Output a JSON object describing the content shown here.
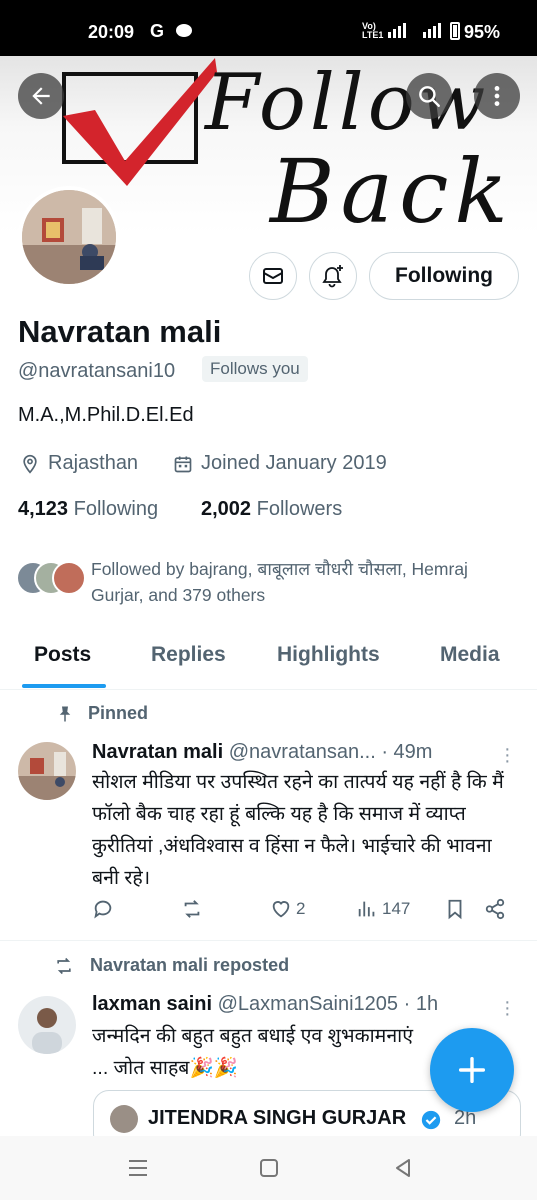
{
  "status_bar": {
    "time": "20:09",
    "g_icon": "G",
    "network": "Vo) 5G LTE1",
    "battery": "95%"
  },
  "banner": {
    "line1": "Follow",
    "line2": "Back"
  },
  "profile": {
    "name": "Navratan mali",
    "handle": "@navratansani10",
    "follows_you": "Follows you",
    "bio": "M.A.,M.Phil.D.El.Ed",
    "location": "Rajasthan",
    "joined": "Joined January 2019",
    "following_count": "4,123",
    "following_label": "Following",
    "followers_count": "2,002",
    "followers_label": "Followers",
    "followed_by": "Followed by bajrang, बाबूलाल चौधरी चौसला, Hemraj Gurjar, and 379 others",
    "following_button": "Following"
  },
  "tabs": [
    "Posts",
    "Replies",
    "Highlights",
    "Media"
  ],
  "active_tab": "Posts",
  "posts": [
    {
      "context": "Pinned",
      "author": "Navratan mali",
      "handle_time": "@navratansan... · 49m",
      "text": "सोशल मीडिया पर उपस्थित रहने का तात्पर्य यह नहीं है कि मैं फॉलो बैक चाह रहा हूं बल्कि यह है कि समाज में व्याप्त कुरीतियां ,अंधविश्वास व हिंसा न फैले। भाईचारे की भावना बनी रहे।",
      "likes": "2",
      "views": "147"
    },
    {
      "context": "Navratan mali reposted",
      "author": "laxman saini",
      "handle_time": "@LaxmanSaini1205 · 1h",
      "text": "जन्मदिन की बहुत बहुत बधाई एव शुभकामनाएं ... जोत साहब🎉🎉",
      "quote_author": "JITENDRA SINGH GURJAR",
      "quote_time": "2h"
    }
  ],
  "colors": {
    "accent": "#1d9bf0",
    "text_primary": "#0f1419",
    "text_secondary": "#536471",
    "border": "#cfd9de",
    "banner_check": "#d3242c"
  }
}
